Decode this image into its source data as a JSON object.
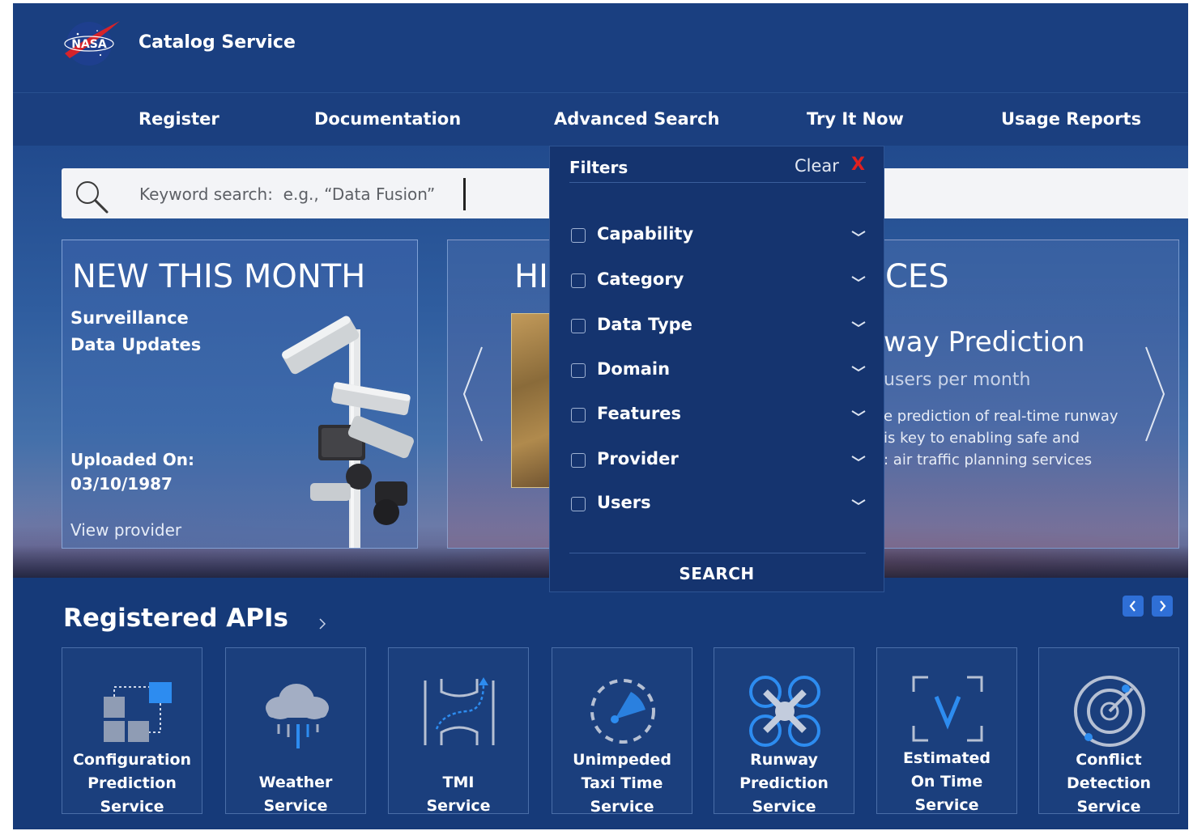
{
  "header": {
    "logo_text": "NASA",
    "title": "Catalog Service"
  },
  "nav": {
    "items": [
      {
        "label": "Register"
      },
      {
        "label": "Documentation"
      },
      {
        "label": "Advanced Search"
      },
      {
        "label": "Try It Now"
      },
      {
        "label": "Usage Reports"
      }
    ]
  },
  "search": {
    "placeholder": "Keyword search:  e.g., “Data Fusion”"
  },
  "new_this_month": {
    "title": "NEW THIS MONTH",
    "subtitle": "Surveillance Data Updates",
    "uploaded_label": "Uploaded On:",
    "uploaded_date": "03/10/1987",
    "view_link": "View provider"
  },
  "highlighted": {
    "title_left": "HI",
    "title_right": "CES",
    "service_name": "way Prediction",
    "users_text": "users per month",
    "description_lines": [
      "e prediction of real-time runway",
      "is key to enabling safe and",
      ": air traffic planning services"
    ]
  },
  "filters": {
    "title": "Filters",
    "clear_label": "Clear",
    "clear_icon": "X",
    "options": [
      {
        "label": "Capability",
        "checked": false
      },
      {
        "label": "Category",
        "checked": false
      },
      {
        "label": "Data Type",
        "checked": false
      },
      {
        "label": "Domain",
        "checked": false
      },
      {
        "label": "Features",
        "checked": false
      },
      {
        "label": "Provider",
        "checked": false
      },
      {
        "label": "Users",
        "checked": false
      }
    ],
    "search_label": "SEARCH"
  },
  "apis": {
    "title": "Registered APIs",
    "tiles": [
      {
        "lines": [
          "Configuration",
          "Prediction",
          "Service"
        ],
        "icon": "config-icon"
      },
      {
        "lines": [
          "Weather",
          "Service"
        ],
        "icon": "cloud-rain-icon"
      },
      {
        "lines": [
          "TMI",
          "Service"
        ],
        "icon": "tmi-route-icon"
      },
      {
        "lines": [
          "Unimpeded",
          "Taxi Time",
          "Service"
        ],
        "icon": "radar-dash-icon"
      },
      {
        "lines": [
          "Runway",
          "Prediction",
          "Service"
        ],
        "icon": "drone-icon"
      },
      {
        "lines": [
          "Estimated",
          "On Time",
          "Service"
        ],
        "icon": "focus-v-icon"
      },
      {
        "lines": [
          "Conflict",
          "Detection",
          "Service"
        ],
        "icon": "radar-icon"
      }
    ]
  },
  "colors": {
    "header_bg": "#1a3f80",
    "panel_bg": "#15346f",
    "accent_blue": "#2f6fd6",
    "clear_red": "#e02020"
  }
}
